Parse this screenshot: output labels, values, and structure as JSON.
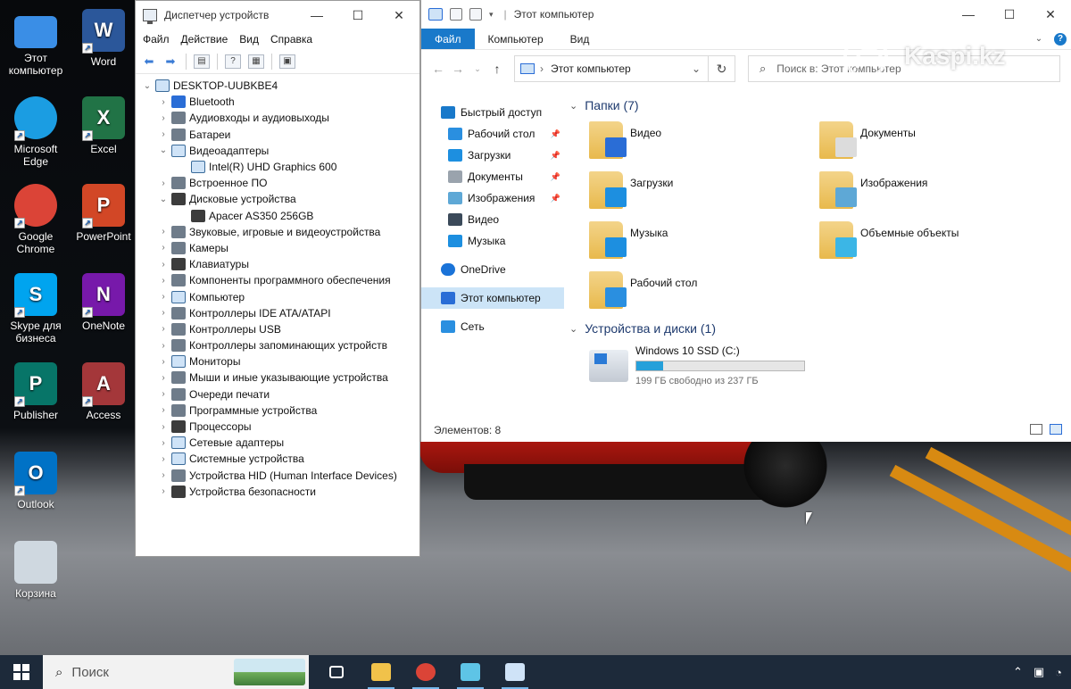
{
  "desktop": {
    "icons": [
      {
        "label": "Этот компьютер",
        "icon": "computer-icon",
        "color": "#3a8ee6"
      },
      {
        "label": "Word",
        "icon": "word-icon",
        "color": "#2b579a",
        "letter": "W"
      },
      {
        "label": "Microsoft Edge",
        "icon": "edge-icon",
        "color": "#1b9de2"
      },
      {
        "label": "Excel",
        "icon": "excel-icon",
        "color": "#217346",
        "letter": "X"
      },
      {
        "label": "Google Chrome",
        "icon": "chrome-icon",
        "color": "#db4437"
      },
      {
        "label": "PowerPoint",
        "icon": "powerpoint-icon",
        "color": "#d24726",
        "letter": "P"
      },
      {
        "label": "Skype для бизнеса",
        "icon": "skype-icon",
        "color": "#00a4ef",
        "letter": "S"
      },
      {
        "label": "OneNote",
        "icon": "onenote-icon",
        "color": "#7719aa",
        "letter": "N"
      },
      {
        "label": "Publisher",
        "icon": "publisher-icon",
        "color": "#077568",
        "letter": "P"
      },
      {
        "label": "Access",
        "icon": "access-icon",
        "color": "#a4373a",
        "letter": "A"
      },
      {
        "label": "Outlook",
        "icon": "outlook-icon",
        "color": "#0072c6",
        "letter": "O"
      },
      {
        "label": "Корзина",
        "icon": "recycle-bin-icon",
        "color": "#cfd8e0"
      }
    ]
  },
  "device_manager": {
    "title": "Диспетчер устройств",
    "menu": [
      "Файл",
      "Действие",
      "Вид",
      "Справка"
    ],
    "root": "DESKTOP-UUBKBE4",
    "tree": [
      {
        "label": "Bluetooth",
        "expanded": false,
        "level": 1,
        "icon": "bluetooth-icon"
      },
      {
        "label": "Аудиовходы и аудиовыходы",
        "expanded": false,
        "level": 1,
        "icon": "audio-icon"
      },
      {
        "label": "Батареи",
        "expanded": false,
        "level": 1,
        "icon": "battery-icon"
      },
      {
        "label": "Видеоадаптеры",
        "expanded": true,
        "level": 1,
        "icon": "display-adapter-icon"
      },
      {
        "label": "Intel(R) UHD Graphics 600",
        "level": 2,
        "icon": "display-adapter-icon"
      },
      {
        "label": "Встроенное ПО",
        "expanded": false,
        "level": 1,
        "icon": "firmware-icon"
      },
      {
        "label": "Дисковые устройства",
        "expanded": true,
        "level": 1,
        "icon": "disk-icon"
      },
      {
        "label": "Apacer AS350 256GB",
        "level": 2,
        "icon": "disk-icon"
      },
      {
        "label": "Звуковые, игровые и видеоустройства",
        "expanded": false,
        "level": 1,
        "icon": "sound-icon"
      },
      {
        "label": "Камеры",
        "expanded": false,
        "level": 1,
        "icon": "camera-icon"
      },
      {
        "label": "Клавиатуры",
        "expanded": false,
        "level": 1,
        "icon": "keyboard-icon"
      },
      {
        "label": "Компоненты программного обеспечения",
        "expanded": false,
        "level": 1,
        "icon": "software-component-icon"
      },
      {
        "label": "Компьютер",
        "expanded": false,
        "level": 1,
        "icon": "computer-icon"
      },
      {
        "label": "Контроллеры IDE ATA/ATAPI",
        "expanded": false,
        "level": 1,
        "icon": "ide-controller-icon"
      },
      {
        "label": "Контроллеры USB",
        "expanded": false,
        "level": 1,
        "icon": "usb-icon"
      },
      {
        "label": "Контроллеры запоминающих устройств",
        "expanded": false,
        "level": 1,
        "icon": "storage-controller-icon"
      },
      {
        "label": "Мониторы",
        "expanded": false,
        "level": 1,
        "icon": "monitor-icon"
      },
      {
        "label": "Мыши и иные указывающие устройства",
        "expanded": false,
        "level": 1,
        "icon": "mouse-icon"
      },
      {
        "label": "Очереди печати",
        "expanded": false,
        "level": 1,
        "icon": "printer-icon"
      },
      {
        "label": "Программные устройства",
        "expanded": false,
        "level": 1,
        "icon": "software-device-icon"
      },
      {
        "label": "Процессоры",
        "expanded": false,
        "level": 1,
        "icon": "processor-icon"
      },
      {
        "label": "Сетевые адаптеры",
        "expanded": false,
        "level": 1,
        "icon": "network-adapter-icon"
      },
      {
        "label": "Системные устройства",
        "expanded": false,
        "level": 1,
        "icon": "system-device-icon"
      },
      {
        "label": "Устройства HID (Human Interface Devices)",
        "expanded": false,
        "level": 1,
        "icon": "hid-icon"
      },
      {
        "label": "Устройства безопасности",
        "expanded": false,
        "level": 1,
        "icon": "security-device-icon"
      }
    ]
  },
  "explorer": {
    "title": "Этот компьютер",
    "tabs": [
      "Файл",
      "Компьютер",
      "Вид"
    ],
    "address": "Этот компьютер",
    "search_placeholder": "Поиск в: Этот компьютер",
    "nav": [
      {
        "label": "Быстрый доступ",
        "icon": "star-icon",
        "indent": 0,
        "pinned": false
      },
      {
        "label": "Рабочий стол",
        "icon": "desktop-folder-icon",
        "indent": 1,
        "pinned": true
      },
      {
        "label": "Загрузки",
        "icon": "download-icon",
        "indent": 1,
        "pinned": true
      },
      {
        "label": "Документы",
        "icon": "documents-icon",
        "indent": 1,
        "pinned": true
      },
      {
        "label": "Изображения",
        "icon": "pictures-icon",
        "indent": 1,
        "pinned": true
      },
      {
        "label": "Видео",
        "icon": "video-icon",
        "indent": 1,
        "pinned": false
      },
      {
        "label": "Музыка",
        "icon": "music-icon",
        "indent": 1,
        "pinned": false
      },
      {
        "label": "OneDrive",
        "icon": "onedrive-icon",
        "indent": 0,
        "pinned": false
      },
      {
        "label": "Этот компьютер",
        "icon": "computer-icon",
        "indent": 0,
        "pinned": false,
        "selected": true
      },
      {
        "label": "Сеть",
        "icon": "network-icon",
        "indent": 0,
        "pinned": false
      }
    ],
    "folders_header": "Папки (7)",
    "folders": [
      {
        "label": "Видео",
        "icon": "video-folder-icon",
        "accent": "#2a6dd6"
      },
      {
        "label": "Документы",
        "icon": "documents-folder-icon",
        "accent": "#dcdcdc"
      },
      {
        "label": "Загрузки",
        "icon": "downloads-folder-icon",
        "accent": "#1d8fe0"
      },
      {
        "label": "Изображения",
        "icon": "pictures-folder-icon",
        "accent": "#5ea8d6"
      },
      {
        "label": "Музыка",
        "icon": "music-folder-icon",
        "accent": "#1d8fe0"
      },
      {
        "label": "Объемные объекты",
        "icon": "3d-objects-folder-icon",
        "accent": "#3bb6e6"
      },
      {
        "label": "Рабочий стол",
        "icon": "desktop-folder-icon",
        "accent": "#2a8fe0"
      }
    ],
    "drives_header": "Устройства и диски (1)",
    "drive": {
      "name": "Windows 10 SSD (C:)",
      "free_text": "199 ГБ свободно из 237 ГБ",
      "used_fraction": 0.16
    },
    "status": "Элементов: 8"
  },
  "watermark": "Kaspi.kz",
  "taskbar": {
    "search_placeholder": "Поиск",
    "apps": [
      {
        "icon": "task-view-icon",
        "color": "#ffffff"
      },
      {
        "icon": "file-explorer-icon",
        "color": "#f1c24a"
      },
      {
        "icon": "chrome-icon",
        "color": "#db4437"
      },
      {
        "icon": "explorer-window-icon",
        "color": "#5ec4e6"
      },
      {
        "icon": "device-manager-icon",
        "color": "#cfe3f7"
      }
    ]
  }
}
